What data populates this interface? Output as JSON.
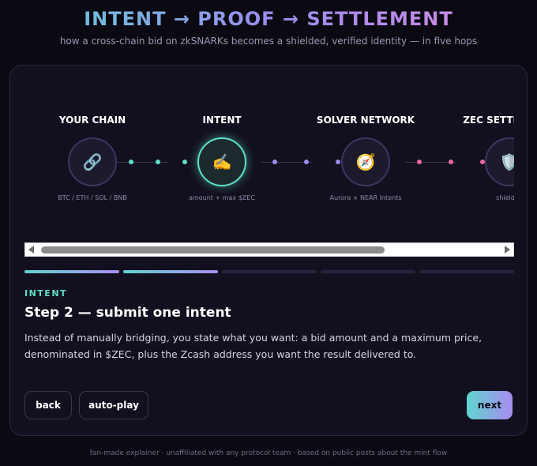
{
  "header": {
    "title": "INTENT → PROOF → SETTLEMENT",
    "subtitle": "how a cross-chain bid on zkSNARKs becomes a shielded, verified identity — in five hops"
  },
  "flow": {
    "nodes": [
      {
        "label": "YOUR CHAIN",
        "icon": "link-icon",
        "glyph": "🔗",
        "caption": "BTC / ETH / SOL / BNB",
        "active": false
      },
      {
        "label": "INTENT",
        "icon": "writing-hand-icon",
        "glyph": "✍️",
        "caption": "amount + max $ZEC",
        "active": true
      },
      {
        "label": "SOLVER NETWORK",
        "icon": "compass-icon",
        "glyph": "🧭",
        "caption": "Aurora × NEAR Intents",
        "active": false
      },
      {
        "label": "ZEC SETTLEMENT",
        "icon": "shield-icon",
        "glyph": "🛡️",
        "caption": "shielded",
        "active": false
      }
    ],
    "connector_dot_colors": [
      "#5fe0c8",
      "#9a8cf0",
      "#e86aa0"
    ]
  },
  "progress": {
    "total_steps": 5,
    "completed_steps": 2
  },
  "step": {
    "tag": "INTENT",
    "title": "Step 2 — submit one intent",
    "body": "Instead of manually bridging, you state what you want: a bid amount and a maximum price, denominated in $ZEC, plus the Zcash address you want the result delivered to."
  },
  "controls": {
    "back_label": "back",
    "autoplay_label": "auto-play",
    "next_label": "next"
  },
  "footer": {
    "text": "fan-made explainer · unaffiliated with any protocol team · based on public posts about the mint flow"
  },
  "colors": {
    "accent_teal": "#5fe0c8",
    "accent_purple": "#a88cf0",
    "accent_pink": "#d98ae0",
    "background": "#0b0a12",
    "card": "#12101e"
  }
}
